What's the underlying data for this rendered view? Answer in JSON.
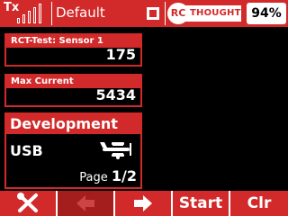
{
  "header": {
    "tx_label": "Tx",
    "model_name": "Default",
    "logo_rc": "RC",
    "logo_word": "THOUGHTS",
    "battery": "94%"
  },
  "sensors": [
    {
      "label": "RCT-Test: Sensor 1",
      "value": "175"
    },
    {
      "label": "Max Current",
      "value": "5434"
    }
  ],
  "panel": {
    "title": "Development",
    "connection": "USB",
    "page_label": "Page",
    "page_value": "1/2"
  },
  "footer": {
    "start": "Start",
    "clear": "Clr"
  },
  "colors": {
    "accent": "#d22a2a",
    "disabled": "#a41e1e"
  },
  "icons": [
    "signal-bars-icon",
    "record-icon",
    "airplane-icon",
    "wrench-screwdriver-icon",
    "arrow-left-icon",
    "arrow-right-icon"
  ]
}
